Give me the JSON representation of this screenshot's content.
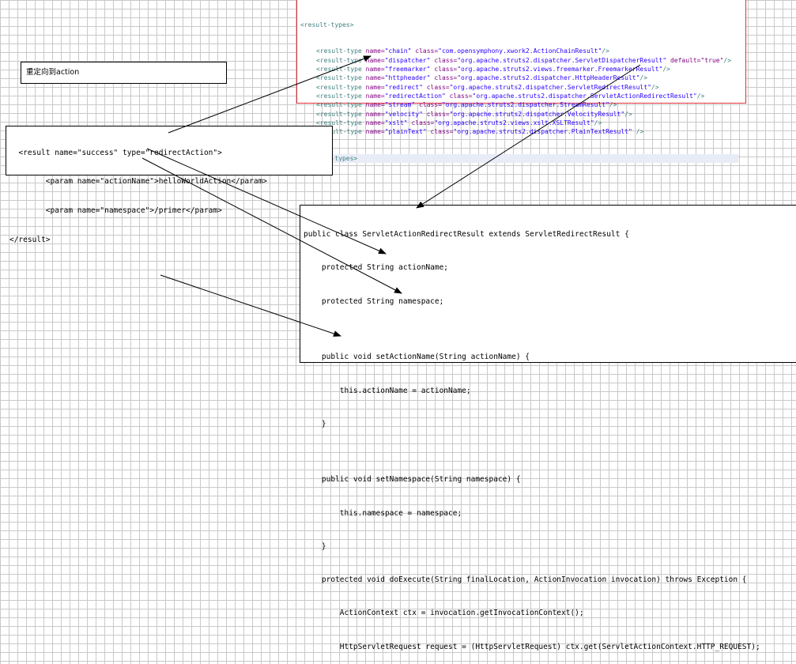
{
  "xml": {
    "open_tag": "<result-types>",
    "entries": [
      {
        "name": "chain",
        "class": "com.opensymphony.xwork2.ActionChainResult",
        "extra": ""
      },
      {
        "name": "dispatcher",
        "class": "org.apache.struts2.dispatcher.ServletDispatcherResult",
        "extra": " default=\"true\""
      },
      {
        "name": "freemarker",
        "class": "org.apache.struts2.views.freemarker.FreemarkerResult",
        "extra": ""
      },
      {
        "name": "httpheader",
        "class": "org.apache.struts2.dispatcher.HttpHeaderResult",
        "extra": ""
      },
      {
        "name": "redirect",
        "class": "org.apache.struts2.dispatcher.ServletRedirectResult",
        "extra": ""
      },
      {
        "name": "redirectAction",
        "class": "org.apache.struts2.dispatcher.ServletActionRedirectResult",
        "extra": ""
      },
      {
        "name": "stream",
        "class": "org.apache.struts2.dispatcher.StreamResult",
        "extra": ""
      },
      {
        "name": "velocity",
        "class": "org.apache.struts2.dispatcher.VelocityResult",
        "extra": ""
      },
      {
        "name": "xslt",
        "class": "org.apache.struts2.views.xslt.XSLTResult",
        "extra": ""
      },
      {
        "name": "plainText",
        "class": "org.apache.struts2.dispatcher.PlainTextResult",
        "extra": " "
      }
    ],
    "entry_prefix": "<result-type",
    "name_attr": "name=",
    "class_attr": "class=",
    "entry_suffix": "/>",
    "close_tag": "</result-types>"
  },
  "note": {
    "text": "重定向到action"
  },
  "result_config": {
    "lines": [
      "  <result name=\"success\" type=\"redirectAction\">",
      "        <param name=\"actionName\">helloWorldAction</param>",
      "        <param name=\"namespace\">/primer</param>",
      "</result>"
    ]
  },
  "java_code": {
    "lines": [
      "public class ServletActionRedirectResult extends ServletRedirectResult {",
      "    protected String actionName;",
      "    protected String namespace;",
      "",
      "    public void setActionName(String actionName) {",
      "        this.actionName = actionName;",
      "    }",
      "",
      "    public void setNamespace(String namespace) {",
      "        this.namespace = namespace;",
      "    }",
      "    protected void doExecute(String finalLocation, ActionInvocation invocation) throws Exception {",
      "        ActionContext ctx = invocation.getInvocationContext();",
      "        HttpServletRequest request = (HttpServletRequest) ctx.get(ServletActionContext.HTTP_REQUEST);"
    ]
  }
}
